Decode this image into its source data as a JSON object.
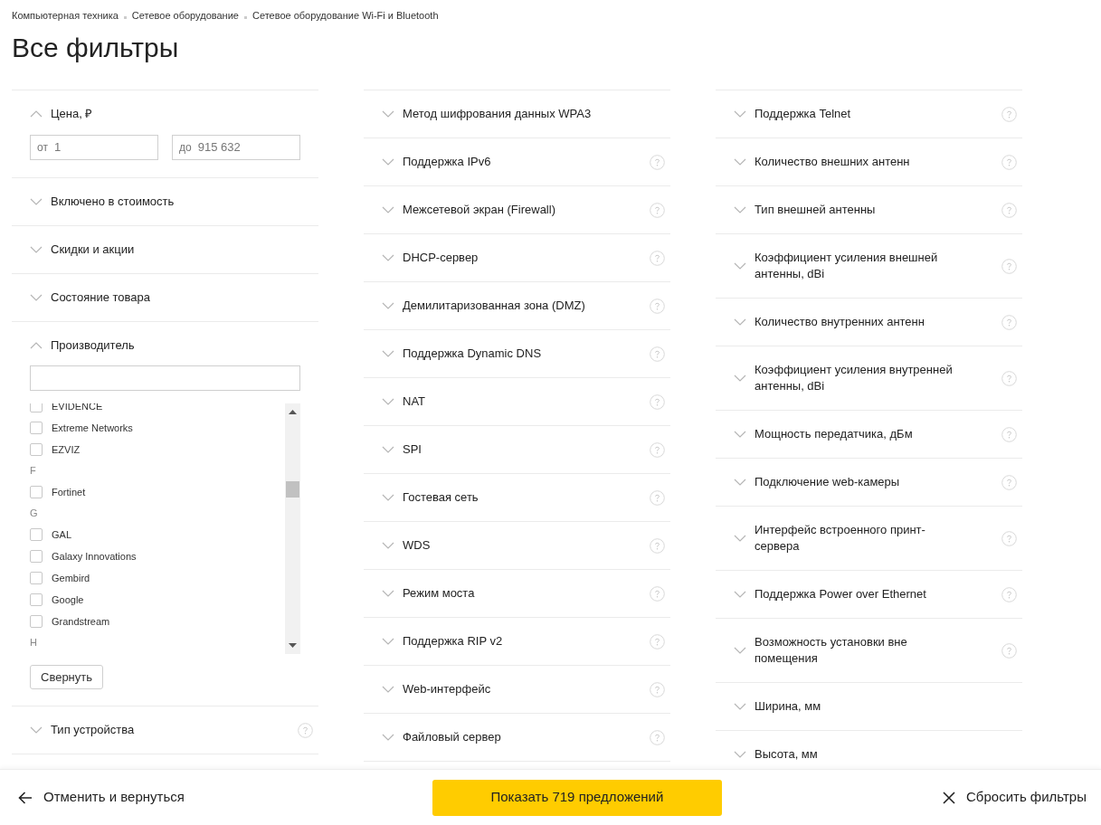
{
  "breadcrumbs": [
    "Компьютерная техника",
    "Сетевое оборудование",
    "Сетевое оборудование Wi-Fi и Bluetooth"
  ],
  "title": "Все фильтры",
  "columns": [
    [
      {
        "kind": "price",
        "label": "Цена, ₽",
        "expanded": true,
        "help": false,
        "from": {
          "prefix": "от",
          "value": "1"
        },
        "to": {
          "prefix": "до",
          "value": "915 632"
        }
      },
      {
        "kind": "plain",
        "label": "Включено в стоимость",
        "expanded": false,
        "help": false
      },
      {
        "kind": "plain",
        "label": "Скидки и акции",
        "expanded": false,
        "help": false
      },
      {
        "kind": "plain",
        "label": "Состояние товара",
        "expanded": false,
        "help": false
      },
      {
        "kind": "list",
        "label": "Производитель",
        "expanded": true,
        "help": false,
        "button": "Свернуть",
        "items": [
          {
            "kind": "brand",
            "label": "EVIDENCE",
            "checked": false
          },
          {
            "kind": "brand",
            "label": "Extreme Networks",
            "checked": false
          },
          {
            "kind": "brand",
            "label": "EZVIZ",
            "checked": false
          },
          {
            "kind": "letter",
            "label": "F"
          },
          {
            "kind": "brand",
            "label": "Fortinet",
            "checked": false
          },
          {
            "kind": "letter",
            "label": "G"
          },
          {
            "kind": "brand",
            "label": "GAL",
            "checked": false
          },
          {
            "kind": "brand",
            "label": "Galaxy Innovations",
            "checked": false
          },
          {
            "kind": "brand",
            "label": "Gembird",
            "checked": false
          },
          {
            "kind": "brand",
            "label": "Google",
            "checked": false
          },
          {
            "kind": "brand",
            "label": "Grandstream",
            "checked": false
          },
          {
            "kind": "letter",
            "label": "H"
          }
        ]
      },
      {
        "kind": "plain",
        "label": "Тип устройства",
        "expanded": false,
        "help": true
      }
    ],
    [
      {
        "kind": "plain",
        "label": "Метод шифрования данных WPA3",
        "expanded": false,
        "help": false
      },
      {
        "kind": "plain",
        "label": "Поддержка IPv6",
        "expanded": false,
        "help": true
      },
      {
        "kind": "plain",
        "label": "Межсетевой экран (Firewall)",
        "expanded": false,
        "help": true
      },
      {
        "kind": "plain",
        "label": "DHCP-сервер",
        "expanded": false,
        "help": true
      },
      {
        "kind": "plain",
        "label": "Демилитаризованная зона (DMZ)",
        "expanded": false,
        "help": true
      },
      {
        "kind": "plain",
        "label": "Поддержка Dynamic DNS",
        "expanded": false,
        "help": true
      },
      {
        "kind": "plain",
        "label": "NAT",
        "expanded": false,
        "help": true
      },
      {
        "kind": "plain",
        "label": "SPI",
        "expanded": false,
        "help": true
      },
      {
        "kind": "plain",
        "label": "Гостевая сеть",
        "expanded": false,
        "help": true
      },
      {
        "kind": "plain",
        "label": "WDS",
        "expanded": false,
        "help": true
      },
      {
        "kind": "plain",
        "label": "Режим моста",
        "expanded": false,
        "help": true
      },
      {
        "kind": "plain",
        "label": "Поддержка RIP v2",
        "expanded": false,
        "help": true
      },
      {
        "kind": "plain",
        "label": "Web-интерфейс",
        "expanded": false,
        "help": true
      },
      {
        "kind": "plain",
        "label": "Файловый сервер",
        "expanded": false,
        "help": true
      }
    ],
    [
      {
        "kind": "plain",
        "label": "Поддержка Telnet",
        "expanded": false,
        "help": true
      },
      {
        "kind": "plain",
        "label": "Количество внешних антенн",
        "expanded": false,
        "help": true
      },
      {
        "kind": "plain",
        "label": "Тип внешней антенны",
        "expanded": false,
        "help": true
      },
      {
        "kind": "plain",
        "label": "Коэффициент усиления внешней антенны, dBi",
        "expanded": false,
        "help": true
      },
      {
        "kind": "plain",
        "label": "Количество внутренних антенн",
        "expanded": false,
        "help": true
      },
      {
        "kind": "plain",
        "label": "Коэффициент усиления внутренней антенны, dBi",
        "expanded": false,
        "help": true
      },
      {
        "kind": "plain",
        "label": "Мощность передатчика, дБм",
        "expanded": false,
        "help": true
      },
      {
        "kind": "plain",
        "label": "Подключение web-камеры",
        "expanded": false,
        "help": true
      },
      {
        "kind": "plain",
        "label": "Интерфейс встроенного принт-сервера",
        "expanded": false,
        "help": true
      },
      {
        "kind": "plain",
        "label": "Поддержка Power over Ethernet",
        "expanded": false,
        "help": true
      },
      {
        "kind": "plain",
        "label": "Возможность установки вне помещения",
        "expanded": false,
        "help": true
      },
      {
        "kind": "plain",
        "label": "Ширина, мм",
        "expanded": false,
        "help": false
      },
      {
        "kind": "plain",
        "label": "Высота, мм",
        "expanded": false,
        "help": false
      }
    ]
  ],
  "footer": {
    "back": "Отменить и вернуться",
    "show": "Показать 719 предложений",
    "reset": "Сбросить фильтры"
  }
}
